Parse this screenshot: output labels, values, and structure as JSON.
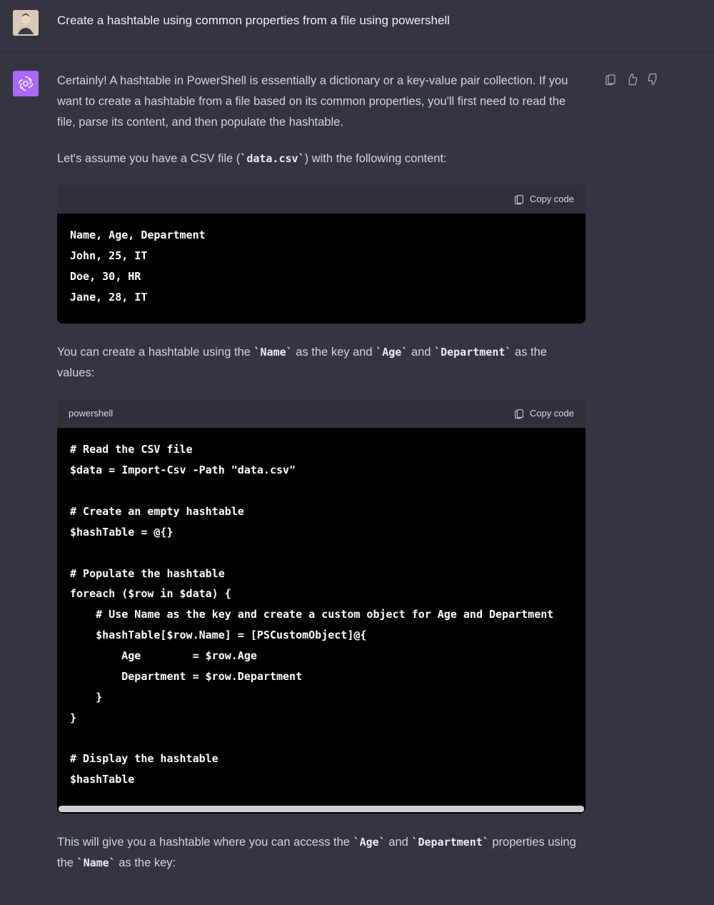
{
  "user": {
    "message": "Create a hashtable using common properties from a file using powershell"
  },
  "assistant": {
    "para1": "Certainly! A hashtable in PowerShell is essentially a dictionary or a key-value pair collection. If you want to create a hashtable from a file based on its common properties, you'll first need to read the file, parse its content, and then populate the hashtable.",
    "para2_pre": "Let's assume you have a CSV file (",
    "para2_code": "data.csv",
    "para2_post": ") with the following content:",
    "codeblock1": {
      "lang": "",
      "copy_label": "Copy code",
      "code": "Name, Age, Department\nJohn, 25, IT\nDoe, 30, HR\nJane, 28, IT"
    },
    "para3_pre": "You can create a hashtable using the ",
    "para3_c1": "Name",
    "para3_mid1": " as the key and ",
    "para3_c2": "Age",
    "para3_mid2": " and ",
    "para3_c3": "Department",
    "para3_post": " as the values:",
    "codeblock2": {
      "lang": "powershell",
      "copy_label": "Copy code",
      "code": "# Read the CSV file\n$data = Import-Csv -Path \"data.csv\"\n\n# Create an empty hashtable\n$hashTable = @{}\n\n# Populate the hashtable\nforeach ($row in $data) {\n    # Use Name as the key and create a custom object for Age and Department\n    $hashTable[$row.Name] = [PSCustomObject]@{\n        Age        = $row.Age\n        Department = $row.Department\n    }\n}\n\n# Display the hashtable\n$hashTable"
    },
    "para4_pre": "This will give you a hashtable where you can access the ",
    "para4_c1": "Age",
    "para4_mid1": " and ",
    "para4_c2": "Department",
    "para4_mid2": " properties using the ",
    "para4_c3": "Name",
    "para4_post": " as the key:"
  },
  "icons": {
    "copy": "clipboard-icon",
    "thumbs_up": "thumbs-up-icon",
    "thumbs_down": "thumbs-down-icon"
  }
}
